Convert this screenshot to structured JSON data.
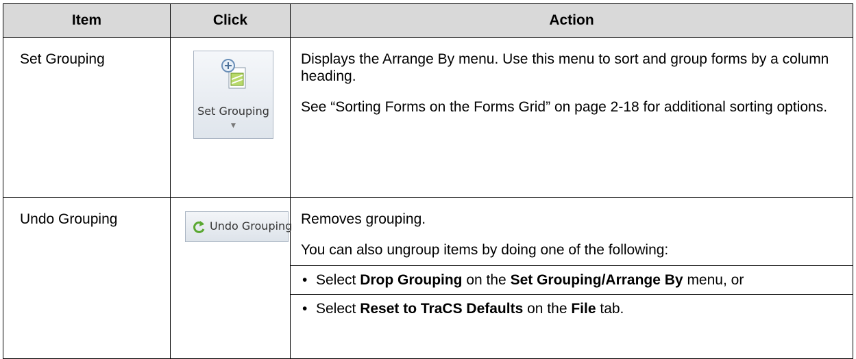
{
  "headers": [
    "Item",
    "Click",
    "Action"
  ],
  "rows": [
    {
      "item": "Set Grouping",
      "click_label": "Set Grouping",
      "click_icon": "set-grouping-icon",
      "action": [
        "Displays the Arrange By menu. Use this menu to sort and group forms by a column heading.",
        "See “Sorting Forms on the Forms Grid” on page 2-18 for additional sorting options."
      ]
    },
    {
      "item": "Undo Grouping",
      "click_label": "Undo Grouping",
      "click_icon": "undo-grouping-icon",
      "action_intro": "Removes grouping.",
      "action_detail": "You can also ungroup items by doing one of the following:",
      "bullets": [
        {
          "t1": "Select ",
          "b1": "Drop Grouping",
          "t2": " on the ",
          "b2": "Set Grouping/Arrange By",
          "t3": " menu, or"
        },
        {
          "t1": "Select ",
          "b1": "Reset to TraCS Defaults",
          "t2": " on the ",
          "b2": "File",
          "t3": " tab."
        }
      ]
    }
  ],
  "colors": {
    "header_bg": "#d9d9d9",
    "border": "#000000",
    "ribbon_border": "#a9b4c2"
  }
}
